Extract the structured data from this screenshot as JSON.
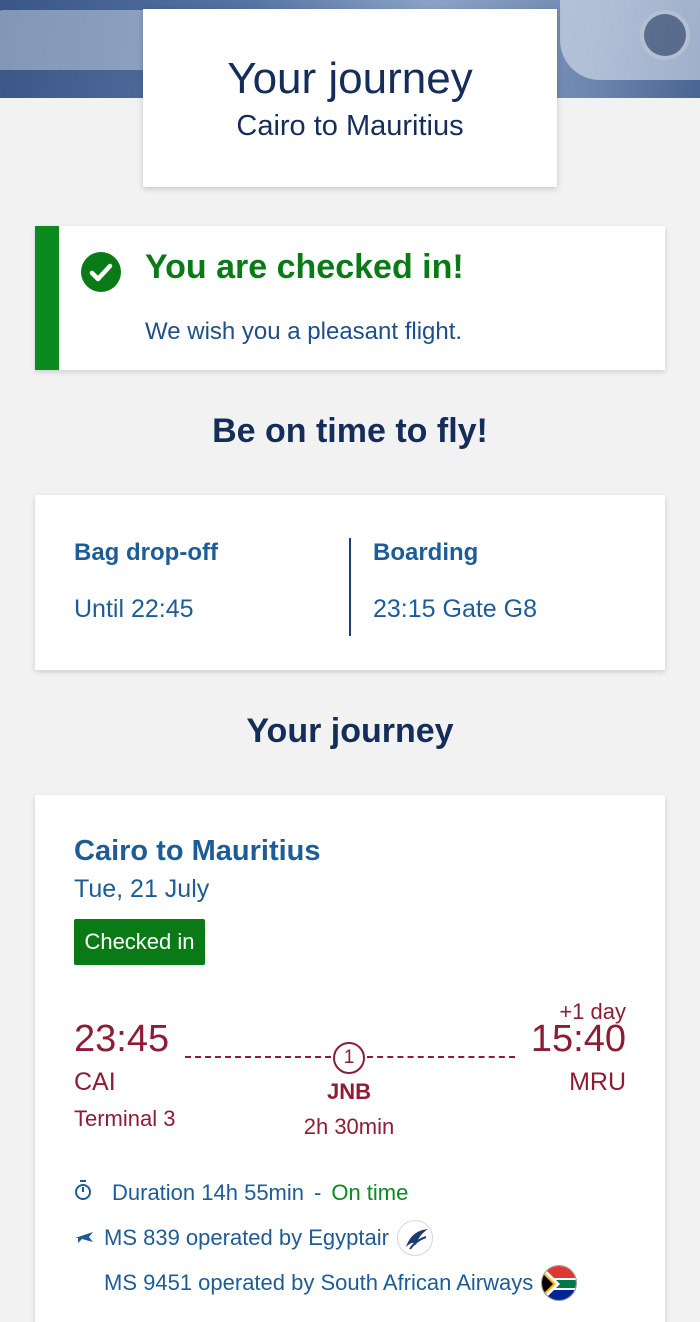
{
  "header": {
    "title": "Your journey",
    "subtitle": "Cairo to Mauritius"
  },
  "checkin": {
    "heading": "You are checked in!",
    "message": "We wish you a pleasant flight."
  },
  "times_section": {
    "title": "Be on time to fly!",
    "bag_label": "Bag drop-off",
    "bag_value": "Until 22:45",
    "boarding_label": "Boarding",
    "boarding_value": "23:15  Gate G8"
  },
  "journey_section": {
    "title": "Your journey",
    "route": "Cairo to Mauritius",
    "date": "Tue, 21 July",
    "status_badge": "Checked in",
    "departure": {
      "time": "23:45",
      "code": "CAI",
      "terminal": "Terminal 3"
    },
    "arrival": {
      "time": "15:40",
      "code": "MRU",
      "day_offset": "+1 day"
    },
    "stop": {
      "count": "1",
      "code": "JNB",
      "layover": "2h 30min"
    },
    "duration": "Duration 14h 55min",
    "separator": "-",
    "status": "On time",
    "flights": [
      {
        "text": "MS 839 operated by Egyptair",
        "logo": "egyptair-logo"
      },
      {
        "text": "MS 9451 operated by South African Airways",
        "logo": "south-africa-flag"
      }
    ]
  },
  "colors": {
    "navy": "#142d59",
    "blue": "#1d5c96",
    "green": "#0a7a17",
    "maroon": "#8c1d35"
  }
}
